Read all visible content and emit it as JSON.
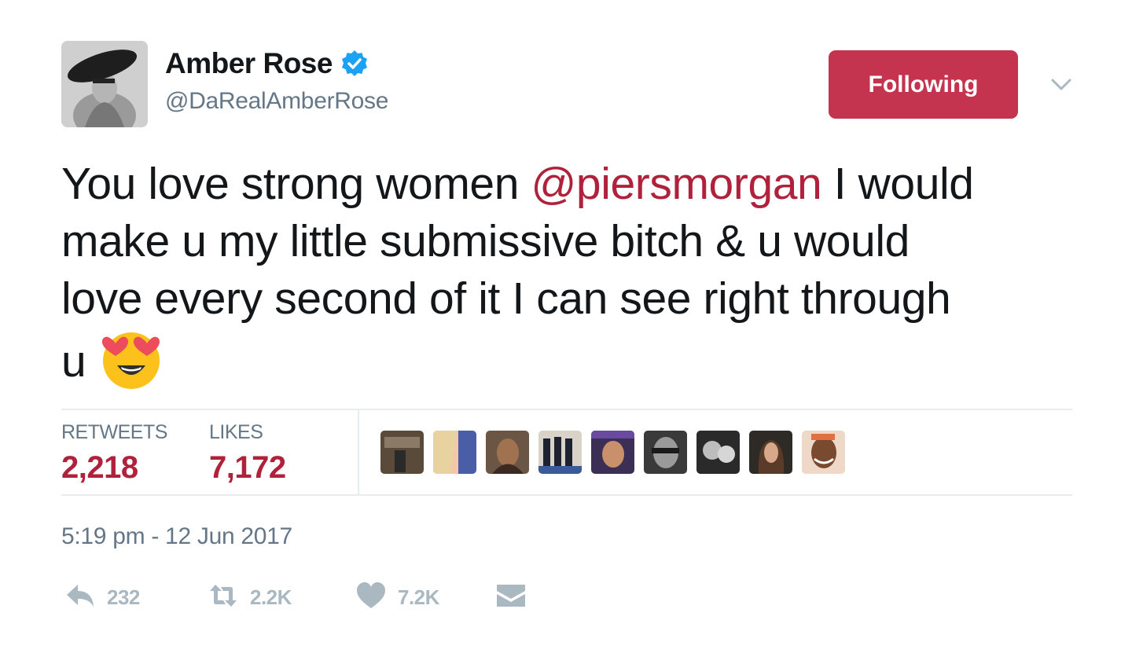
{
  "author": {
    "display_name": "Amber Rose",
    "handle": "@DaRealAmberRose",
    "verified": true,
    "verified_color": "#1da1f2"
  },
  "follow_button": {
    "label": "Following",
    "color": "#c4344f"
  },
  "tweet": {
    "line1_a": "You love strong women ",
    "line1_mention": "@piersmorgan",
    "line1_b": " I would",
    "line2": "make u my little submissive bitch & u would",
    "line3": "love every second of it I can see right through",
    "line4": "u",
    "emoji": "smiling-face-with-heart-eyes",
    "mention_color": "#b0223c"
  },
  "stats": {
    "retweets_label": "RETWEETS",
    "retweets_value": "2,218",
    "likes_label": "LIKES",
    "likes_value": "7,172"
  },
  "timestamp": "5:19 pm - 12 Jun 2017",
  "actions": {
    "reply_count": "232",
    "retweet_count": "2.2K",
    "like_count": "7.2K"
  },
  "icons": [
    "verified-badge-icon",
    "chevron-down-icon",
    "reply-icon",
    "retweet-icon",
    "heart-icon",
    "envelope-icon"
  ]
}
